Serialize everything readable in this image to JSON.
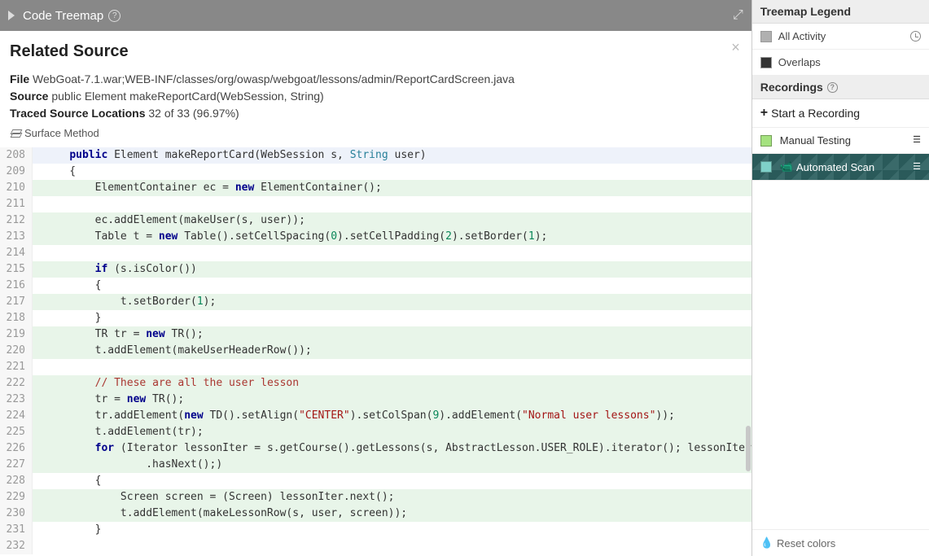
{
  "titlebar": {
    "title": "Code Treemap"
  },
  "header": {
    "title": "Related Source",
    "file_label": "File",
    "file_value": "WebGoat-7.1.war;WEB-INF/classes/org/owasp/webgoat/lessons/admin/ReportCardScreen.java",
    "source_label": "Source",
    "source_value": "public Element makeReportCard(WebSession, String)",
    "traced_label": "Traced Source Locations",
    "traced_value": "32 of 33 (96.97%)",
    "surface": "Surface Method"
  },
  "code": [
    {
      "n": "208",
      "hl": "blue",
      "tokens": [
        [
          "    ",
          ""
        ],
        [
          "public",
          "kw"
        ],
        [
          " Element makeReportCard(WebSession s, ",
          ""
        ],
        [
          "String",
          "type"
        ],
        [
          " user)",
          ""
        ]
      ]
    },
    {
      "n": "209",
      "hl": "",
      "tokens": [
        [
          "    {",
          ""
        ]
      ]
    },
    {
      "n": "210",
      "hl": "green",
      "tokens": [
        [
          "        ElementContainer ec = ",
          ""
        ],
        [
          "new",
          "kw"
        ],
        [
          " ElementContainer();",
          ""
        ]
      ]
    },
    {
      "n": "211",
      "hl": "",
      "tokens": [
        [
          "",
          ""
        ]
      ]
    },
    {
      "n": "212",
      "hl": "green",
      "tokens": [
        [
          "        ec.addElement(makeUser(s, user));",
          ""
        ]
      ]
    },
    {
      "n": "213",
      "hl": "green",
      "tokens": [
        [
          "        Table t = ",
          ""
        ],
        [
          "new",
          "kw"
        ],
        [
          " Table().setCellSpacing(",
          ""
        ],
        [
          "0",
          "num-lit"
        ],
        [
          ").setCellPadding(",
          ""
        ],
        [
          "2",
          "num-lit"
        ],
        [
          ").setBorder(",
          ""
        ],
        [
          "1",
          "num-lit"
        ],
        [
          ");",
          ""
        ]
      ]
    },
    {
      "n": "214",
      "hl": "",
      "tokens": [
        [
          "",
          ""
        ]
      ]
    },
    {
      "n": "215",
      "hl": "green",
      "tokens": [
        [
          "        ",
          ""
        ],
        [
          "if",
          "kw"
        ],
        [
          " (s.isColor())",
          ""
        ]
      ]
    },
    {
      "n": "216",
      "hl": "",
      "tokens": [
        [
          "        {",
          ""
        ]
      ]
    },
    {
      "n": "217",
      "hl": "green",
      "tokens": [
        [
          "            t.setBorder(",
          ""
        ],
        [
          "1",
          "num-lit"
        ],
        [
          ");",
          ""
        ]
      ]
    },
    {
      "n": "218",
      "hl": "",
      "tokens": [
        [
          "        }",
          ""
        ]
      ]
    },
    {
      "n": "219",
      "hl": "green",
      "tokens": [
        [
          "        TR tr = ",
          ""
        ],
        [
          "new",
          "kw"
        ],
        [
          " TR();",
          ""
        ]
      ]
    },
    {
      "n": "220",
      "hl": "green",
      "tokens": [
        [
          "        t.addElement(makeUserHeaderRow());",
          ""
        ]
      ]
    },
    {
      "n": "221",
      "hl": "",
      "tokens": [
        [
          "",
          ""
        ]
      ]
    },
    {
      "n": "222",
      "hl": "green",
      "tokens": [
        [
          "        ",
          ""
        ],
        [
          "// These are all the user lesson",
          "cmt"
        ]
      ]
    },
    {
      "n": "223",
      "hl": "green",
      "tokens": [
        [
          "        tr = ",
          ""
        ],
        [
          "new",
          "kw"
        ],
        [
          " TR();",
          ""
        ]
      ]
    },
    {
      "n": "224",
      "hl": "green",
      "tokens": [
        [
          "        tr.addElement(",
          ""
        ],
        [
          "new",
          "kw"
        ],
        [
          " TD().setAlign(",
          ""
        ],
        [
          "\"CENTER\"",
          "str"
        ],
        [
          ").setColSpan(",
          ""
        ],
        [
          "9",
          "num-lit"
        ],
        [
          ").addElement(",
          ""
        ],
        [
          "\"Normal user lessons\"",
          "str"
        ],
        [
          "));",
          ""
        ]
      ]
    },
    {
      "n": "225",
      "hl": "green",
      "tokens": [
        [
          "        t.addElement(tr);",
          ""
        ]
      ]
    },
    {
      "n": "226",
      "hl": "green",
      "tokens": [
        [
          "        ",
          ""
        ],
        [
          "for",
          "kw"
        ],
        [
          " (Iterator lessonIter = s.getCourse().getLessons(s, AbstractLesson.USER_ROLE).iterator(); lessonIter",
          ""
        ]
      ]
    },
    {
      "n": "227",
      "hl": "green",
      "tokens": [
        [
          "                .hasNext();)",
          ""
        ]
      ]
    },
    {
      "n": "228",
      "hl": "",
      "tokens": [
        [
          "        {",
          ""
        ]
      ]
    },
    {
      "n": "229",
      "hl": "green",
      "tokens": [
        [
          "            Screen screen = (Screen) lessonIter.next();",
          ""
        ]
      ]
    },
    {
      "n": "230",
      "hl": "green",
      "tokens": [
        [
          "            t.addElement(makeLessonRow(s, user, screen));",
          ""
        ]
      ]
    },
    {
      "n": "231",
      "hl": "",
      "tokens": [
        [
          "        }",
          ""
        ]
      ]
    },
    {
      "n": "232",
      "hl": "",
      "tokens": [
        [
          "",
          ""
        ]
      ]
    }
  ],
  "legend": {
    "title": "Treemap Legend",
    "items": [
      {
        "label": "All Activity",
        "color": "#b0b0b0",
        "clock": true
      },
      {
        "label": "Overlaps",
        "color": "#333333",
        "clock": false
      }
    ]
  },
  "recordings": {
    "title": "Recordings",
    "start": "Start a Recording",
    "items": [
      {
        "label": "Manual Testing",
        "color": "#a5e27f",
        "active": false,
        "cam": false
      },
      {
        "label": "Automated Scan",
        "color": "#7fd1c9",
        "active": true,
        "cam": true
      }
    ]
  },
  "reset": "Reset colors"
}
